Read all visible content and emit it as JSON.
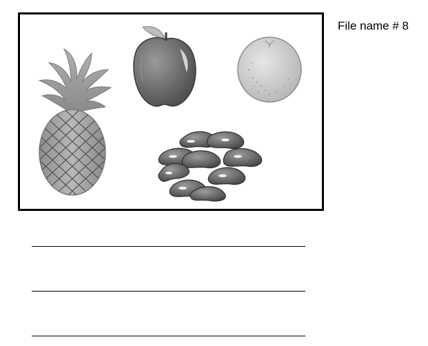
{
  "worksheet": {
    "file_label": "File name # 8",
    "picture": {
      "items": [
        "pineapple-icon",
        "apple-icon",
        "orange-icon",
        "beans-icon"
      ]
    },
    "answer_lines": 3
  }
}
